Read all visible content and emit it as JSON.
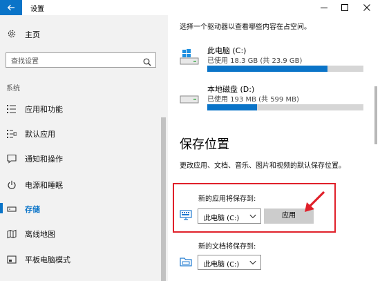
{
  "window": {
    "title": "设置"
  },
  "sidebar": {
    "home_label": "主页",
    "search_placeholder": "查找设置",
    "section_label": "系统",
    "items": [
      {
        "label": "应用和功能",
        "icon": "list-icon"
      },
      {
        "label": "默认应用",
        "icon": "default-apps-icon"
      },
      {
        "label": "通知和操作",
        "icon": "notification-icon"
      },
      {
        "label": "电源和睡眠",
        "icon": "power-icon"
      },
      {
        "label": "存储",
        "icon": "storage-icon",
        "active": true
      },
      {
        "label": "离线地图",
        "icon": "map-icon"
      },
      {
        "label": "平板电脑模式",
        "icon": "tablet-icon"
      }
    ]
  },
  "content": {
    "intro": "选择一个驱动器以查看哪些内容在占空间。",
    "drives": [
      {
        "name": "此电脑 (C:)",
        "usage": "已使用 18.3 GB (共 23.9 GB)",
        "used_fraction": 0.77
      },
      {
        "name": "本地磁盘 (D:)",
        "usage": "已使用 193 MB (共 599 MB)",
        "used_fraction": 0.32
      }
    ],
    "save_section": {
      "title": "保存位置",
      "description": "更改应用、文档、音乐、图片和视频的默认保存位置。",
      "apps": {
        "label": "新的应用将保存到:",
        "selected": "此电脑 (C:)",
        "apply_label": "应用"
      },
      "documents": {
        "label": "新的文档将保存到:",
        "selected": "此电脑 (C:)"
      }
    }
  },
  "colors": {
    "accent": "#0a74c8",
    "highlight": "#e0202a"
  }
}
